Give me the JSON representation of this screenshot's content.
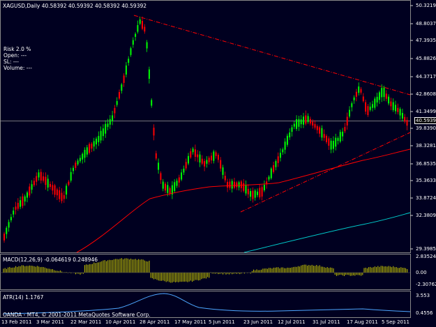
{
  "header": {
    "symbol_line": "XAGUSD,Daily  40.58392 40.59392 40.58392 40.59392"
  },
  "info_panel": {
    "risk": "Risk   2.0 %",
    "open": "Open:    ---",
    "sl": "SL:    ---",
    "volume": "Volume:    ---"
  },
  "price_axis": {
    "ticks": [
      "50.3219",
      "48.8037",
      "47.3935",
      "45.8826",
      "44.3717",
      "42.8608",
      "41.3499",
      "39.8390",
      "38.3281",
      "36.8535",
      "35.3633",
      "33.8724",
      "32.3809",
      "29.3985"
    ],
    "current": "40.5939"
  },
  "macd": {
    "label": "MACD(12,26,9) -0.064619 0.248946",
    "ticks": [
      "2.835249",
      "0.00",
      "-2.307627"
    ]
  },
  "atr": {
    "label": "ATR(14) 1.1767",
    "ticks": [
      "3.553",
      "0.4556"
    ]
  },
  "copyright": "OANDA - MT4, © 2001-2011 MetaQuotes Software Corp.",
  "date_axis": [
    "13 Feb 2011",
    "3 Mar 2011",
    "22 Mar 2011",
    "10 Apr 2011",
    "28 Apr 2011",
    "17 May 2011",
    "5 Jun 2011",
    "23 Jun 2011",
    "12 Jul 2011",
    "31 Jul 2011",
    "17 Aug 2011",
    "5 Sep 2011"
  ],
  "colors": {
    "background": "#000020",
    "bull": "#00ff00",
    "bear": "#ff0000",
    "ma_short": "#ff0000",
    "ma_long": "#00cccc",
    "trendline": "#ff0000",
    "macd_hist": "#cccc00",
    "atr_line": "#4da6ff"
  }
}
